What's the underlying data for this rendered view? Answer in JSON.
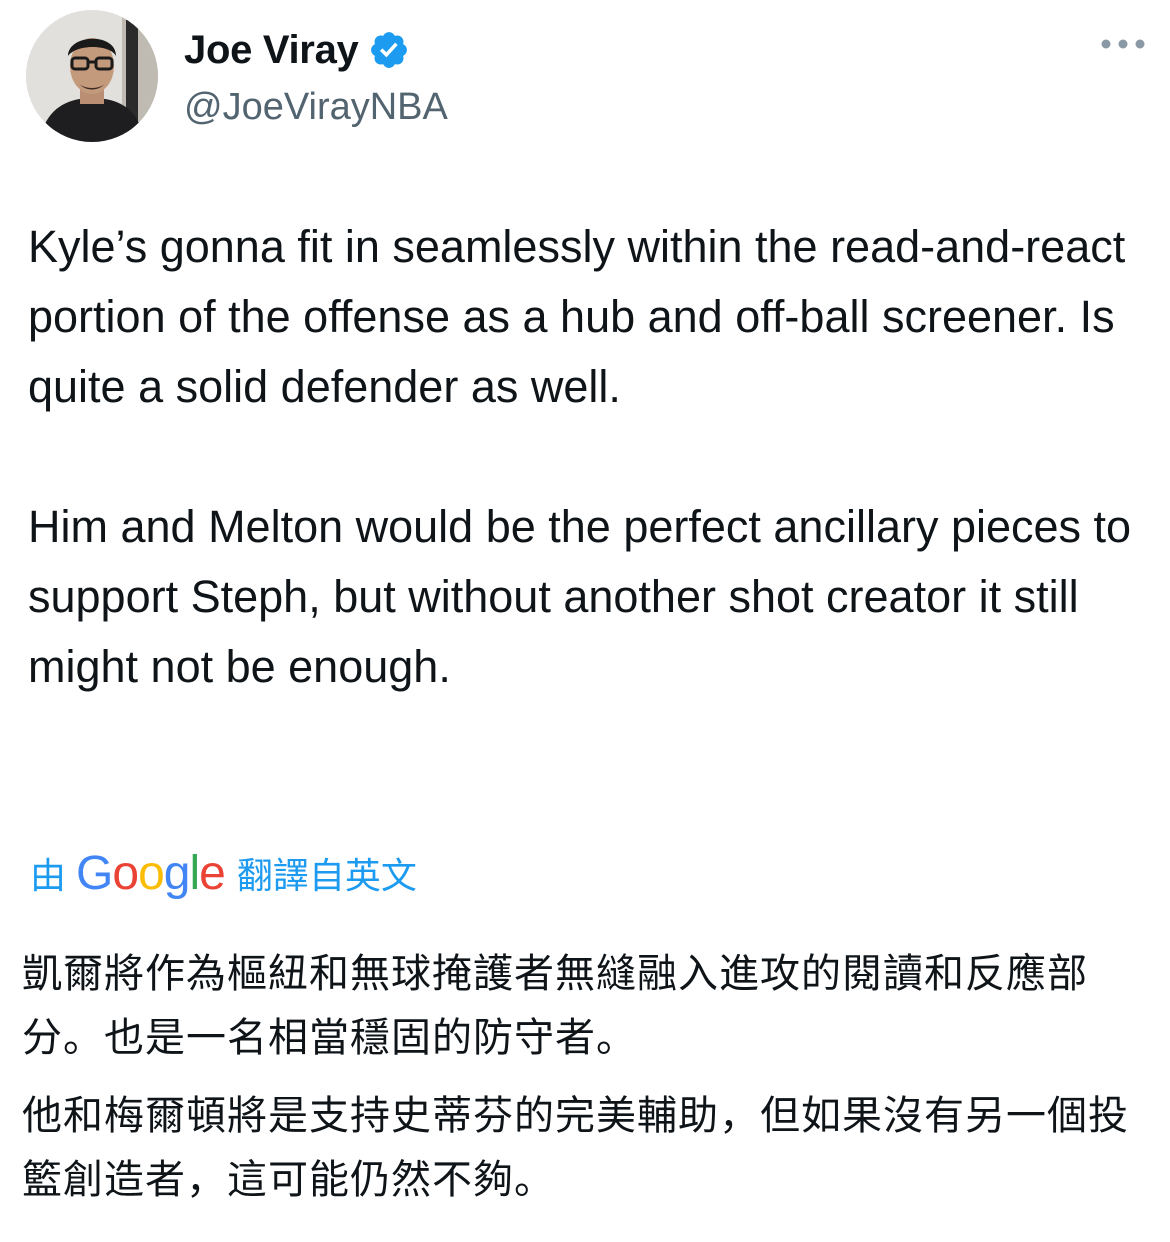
{
  "author": {
    "display_name": "Joe Viray",
    "handle": "@JoeVirayNBA",
    "verified_icon": "verified-badge-icon",
    "verified_color": "#1d9bf0"
  },
  "menu": {
    "icon": "more-options-icon"
  },
  "tweet": {
    "paragraphs": [
      "Kyle’s gonna fit in seamlessly within the read-and-react portion of the offense as a hub and off-ball screener. Is quite a solid defender as well.",
      "Him and Melton would be the perfect ancillary pieces to support Steph, but without another shot creator it still might not be enough."
    ]
  },
  "translation": {
    "prefix": "由",
    "provider_logo": [
      "G",
      "o",
      "o",
      "g",
      "l",
      "e"
    ],
    "suffix": "翻譯自英文",
    "link_color": "#1d9bf0",
    "paragraphs": [
      "凱爾將作為樞紐和無球掩護者無縫融入進攻的閱讀和反應部分。也是一名相當穩固的防守者。",
      "他和梅爾頓將是支持史蒂芬的完美輔助，但如果沒有另一個投籃創造者，這可能仍然不夠。"
    ]
  }
}
